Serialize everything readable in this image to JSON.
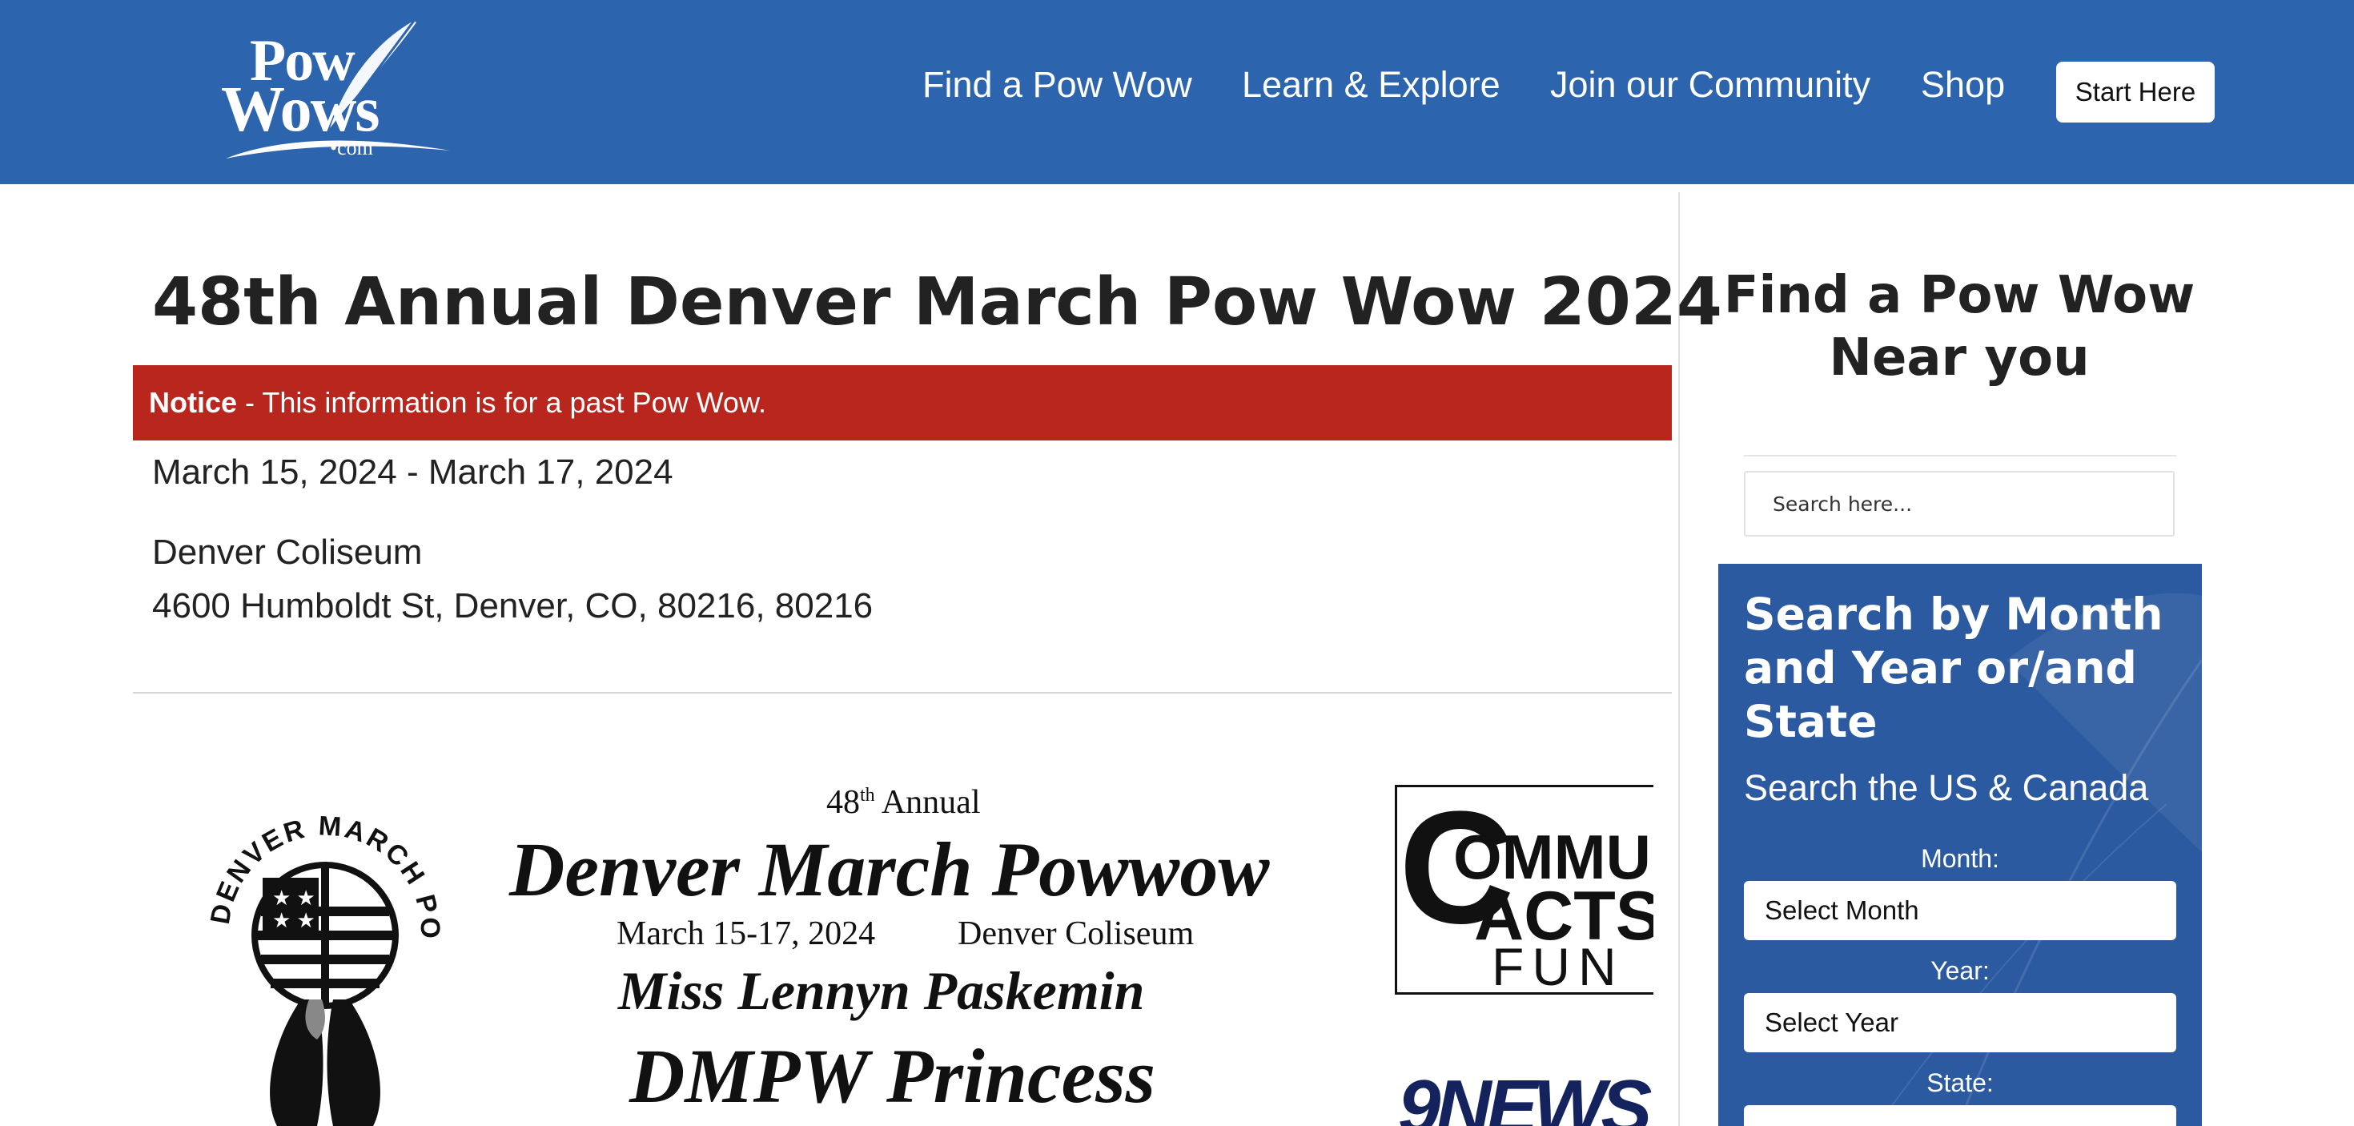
{
  "header": {
    "logo": {
      "line1": "Pow",
      "line2": "Wows",
      "line3": "•com"
    },
    "nav": [
      "Find a Pow Wow",
      "Learn & Explore",
      "Join our Community",
      "Shop"
    ],
    "cta": "Start Here"
  },
  "event": {
    "title": "48th Annual Denver March Pow Wow 2024",
    "notice_label": "Notice",
    "notice_text": " - This information is for a past Pow Wow.",
    "dates": "March 15, 2024 - March 17, 2024",
    "venue": "Denver Coliseum",
    "address": "4600 Humboldt St, Denver, CO, 80216, 80216"
  },
  "poster": {
    "seal_text": "DENVER MARCH POW-WOW",
    "annual_num": "48",
    "annual_sup": "th",
    "annual_word": " Annual",
    "title": "Denver March Powwow",
    "dates": "March 15-17, 2024",
    "location": "Denver Coliseum",
    "miss": "Miss Lennyn Paskemin",
    "princess": "DMPW Princess",
    "sponsor1_line1": "OMMUNIT",
    "sponsor1_line2": "ACTS",
    "sponsor1_line3": "FUN",
    "sponsor2": "9NEWS"
  },
  "sidebar": {
    "title": "Find a Pow Wow Near you",
    "search_placeholder": "Search here...",
    "panel_title": "Search by Month and Year or/and State",
    "panel_subtitle": "Search the US & Canada",
    "month_label": "Month:",
    "month_value": "Select Month",
    "year_label": "Year:",
    "year_value": "Select Year",
    "state_label": "State:"
  },
  "colors": {
    "header_bg": "#2d64ae",
    "notice_bg": "#b9261d",
    "panel_bg": "#2b5aa0"
  }
}
